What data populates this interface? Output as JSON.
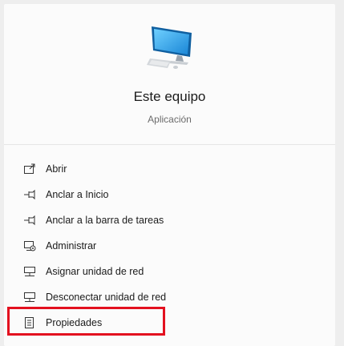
{
  "app": {
    "title": "Este equipo",
    "subtitle": "Aplicación",
    "icon": "this-pc-icon"
  },
  "menu": {
    "items": [
      {
        "label": "Abrir",
        "icon": "open-icon"
      },
      {
        "label": "Anclar a Inicio",
        "icon": "pin-icon"
      },
      {
        "label": "Anclar a la barra de tareas",
        "icon": "pin-icon"
      },
      {
        "label": "Administrar",
        "icon": "manage-icon"
      },
      {
        "label": "Asignar unidad de red",
        "icon": "network-drive-icon"
      },
      {
        "label": "Desconectar unidad de red",
        "icon": "network-drive-icon"
      },
      {
        "label": "Propiedades",
        "icon": "properties-icon"
      }
    ]
  },
  "highlight": {
    "target": "Propiedades",
    "color": "#e3101f"
  }
}
